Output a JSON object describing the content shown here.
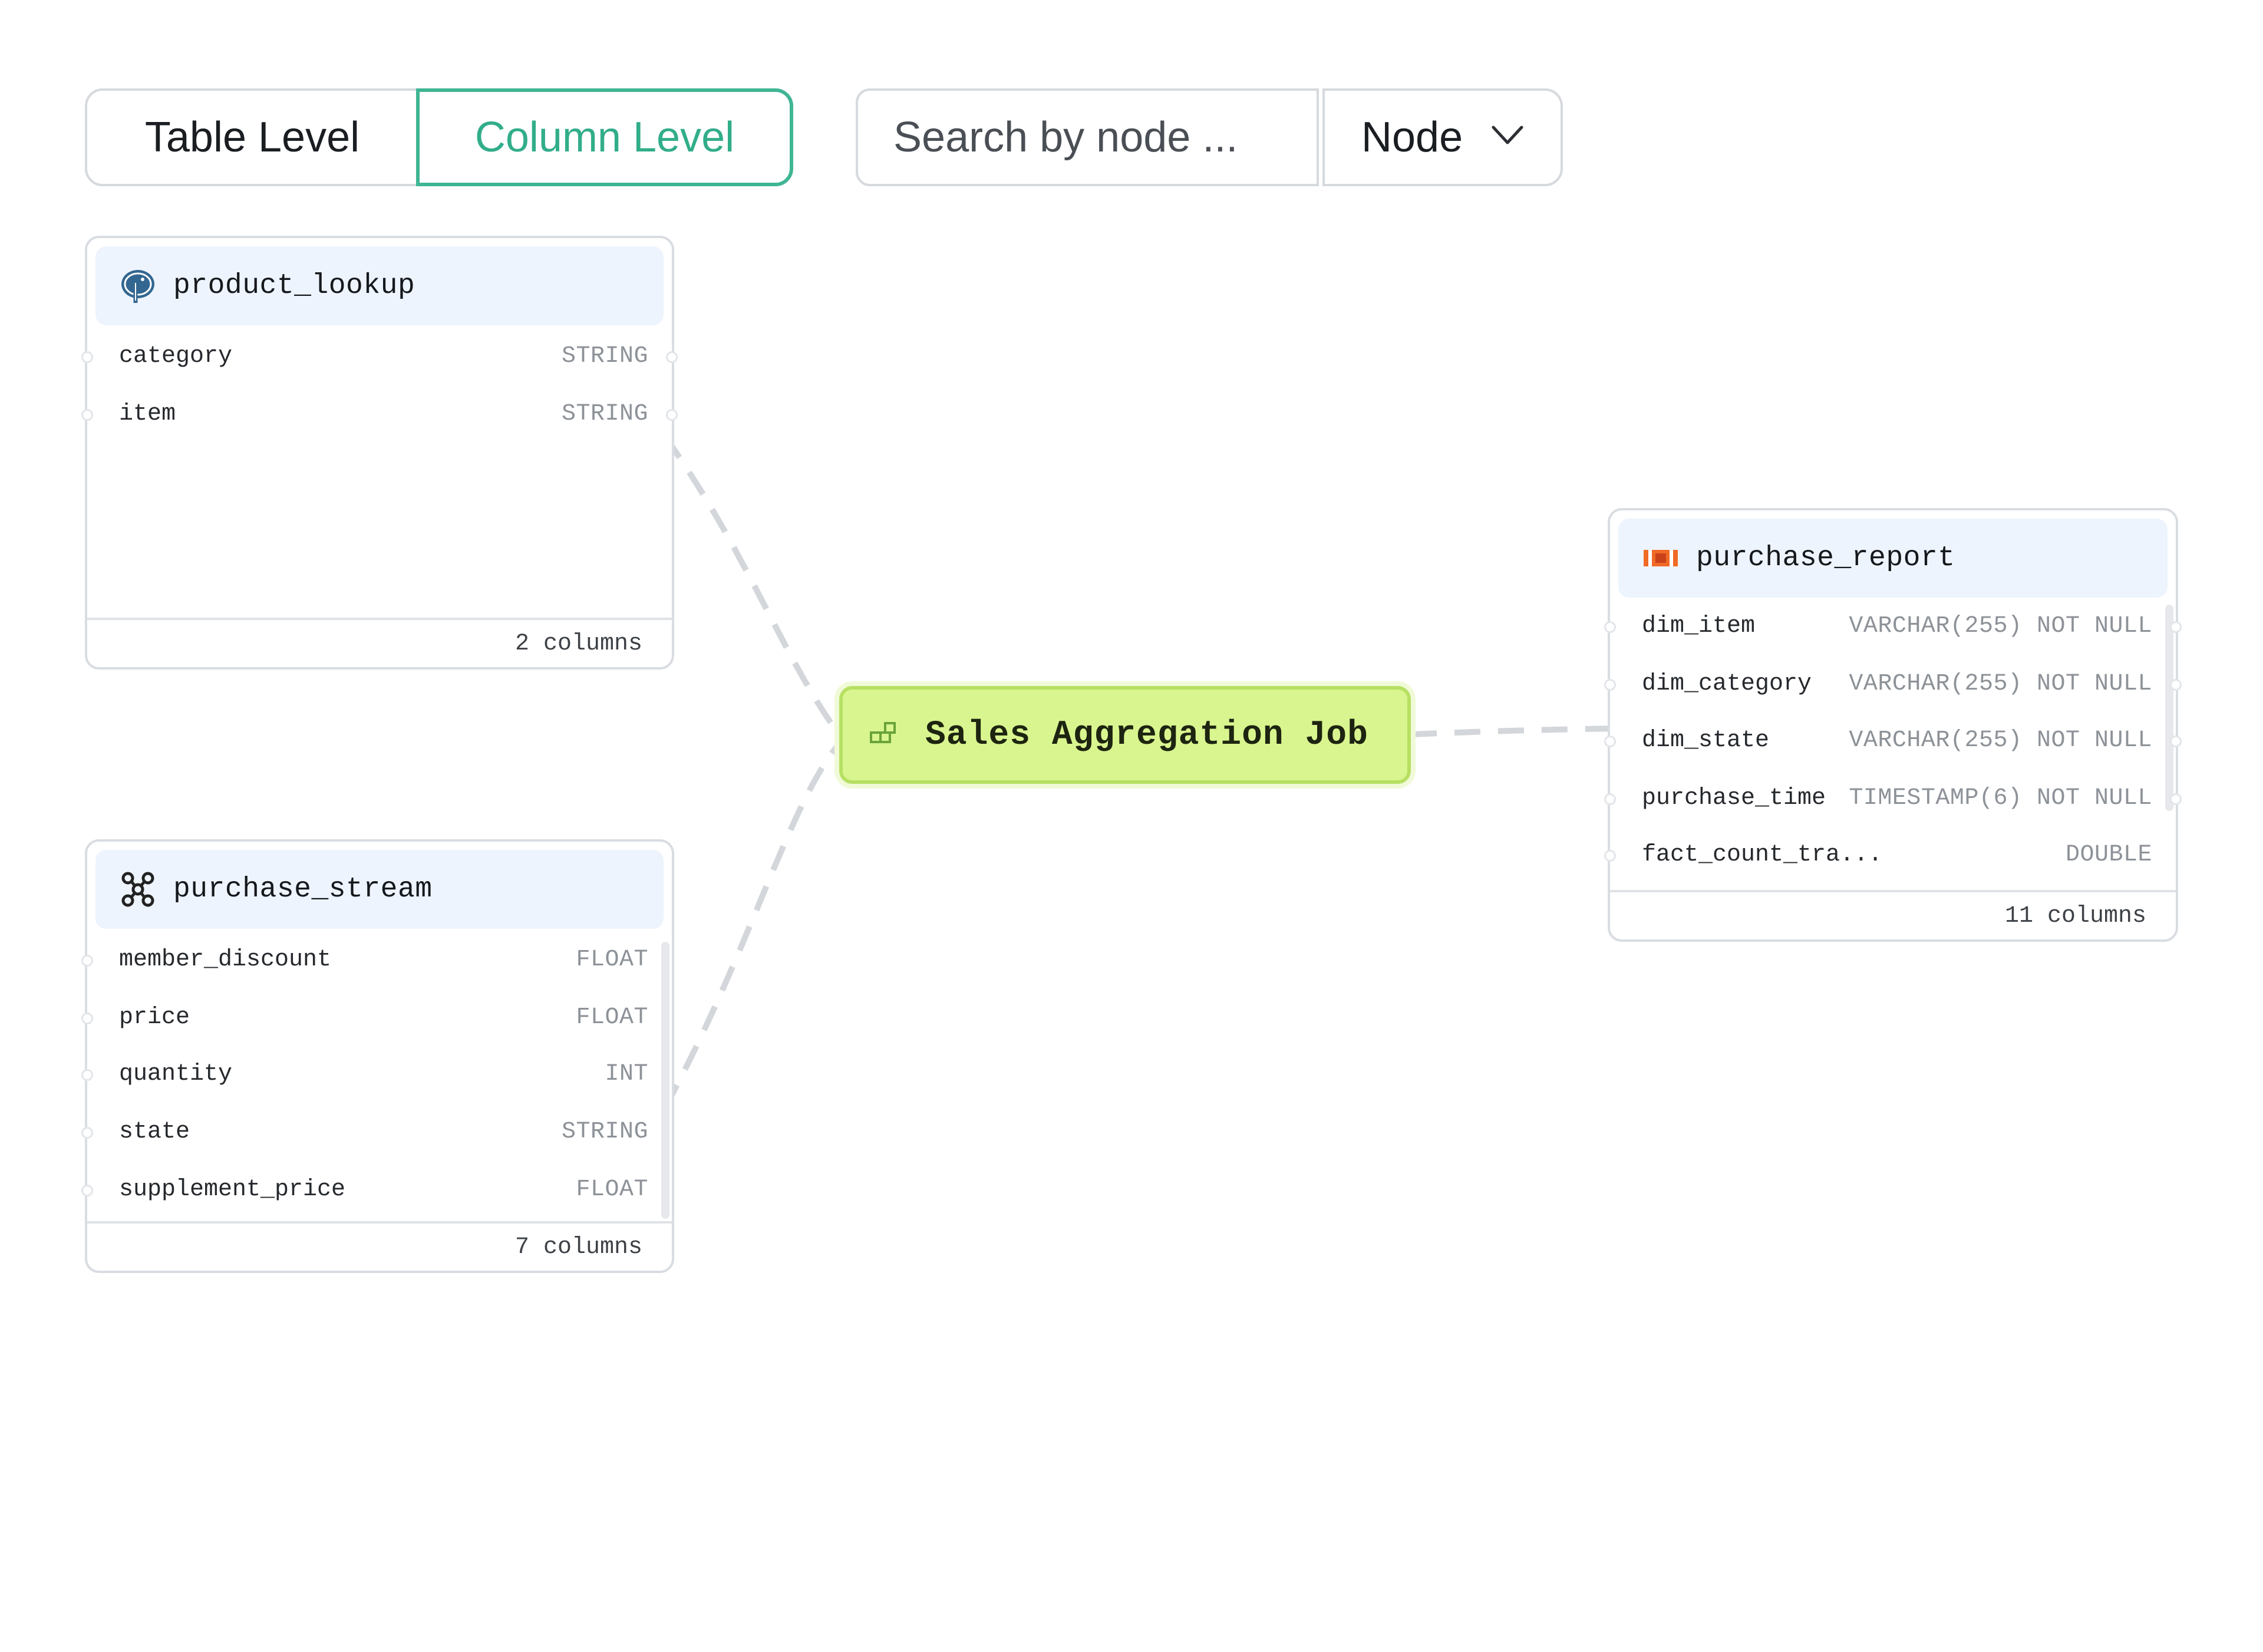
{
  "toolbar": {
    "table_level_label": "Table Level",
    "column_level_label": "Column Level",
    "active_level": "Column Level",
    "search_placeholder": "Search by node ...",
    "node_select_value": "Node"
  },
  "nodes": {
    "product_lookup": {
      "title": "product_lookup",
      "icon": "postgresql-elephant-icon",
      "columns": [
        {
          "name": "category",
          "type": "STRING"
        },
        {
          "name": "item",
          "type": "STRING"
        }
      ],
      "footer": "2 columns"
    },
    "purchase_stream": {
      "title": "purchase_stream",
      "icon": "kafka-stream-icon",
      "columns": [
        {
          "name": "member_discount",
          "type": "FLOAT"
        },
        {
          "name": "price",
          "type": "FLOAT"
        },
        {
          "name": "quantity",
          "type": "INT"
        },
        {
          "name": "state",
          "type": "STRING"
        },
        {
          "name": "supplement_price",
          "type": "FLOAT"
        }
      ],
      "footer": "7 columns"
    },
    "purchase_report": {
      "title": "purchase_report",
      "icon": "iceberg-table-icon",
      "columns": [
        {
          "name": "dim_item",
          "type": "VARCHAR(255) NOT NULL"
        },
        {
          "name": "dim_category",
          "type": "VARCHAR(255) NOT NULL"
        },
        {
          "name": "dim_state",
          "type": "VARCHAR(255) NOT NULL"
        },
        {
          "name": "purchase_time",
          "type": "TIMESTAMP(6) NOT NULL"
        },
        {
          "name": "fact_count_tra...",
          "type": "DOUBLE"
        }
      ],
      "footer": "11 columns"
    },
    "job": {
      "title": "Sales Aggregation Job",
      "icon": "job-blocks-icon"
    }
  },
  "colors": {
    "accent": "#3fb594",
    "job_fill": "#d9f58f",
    "job_border": "#b7e063",
    "card_header": "#eef4fd",
    "edge": "#d3d6da"
  }
}
